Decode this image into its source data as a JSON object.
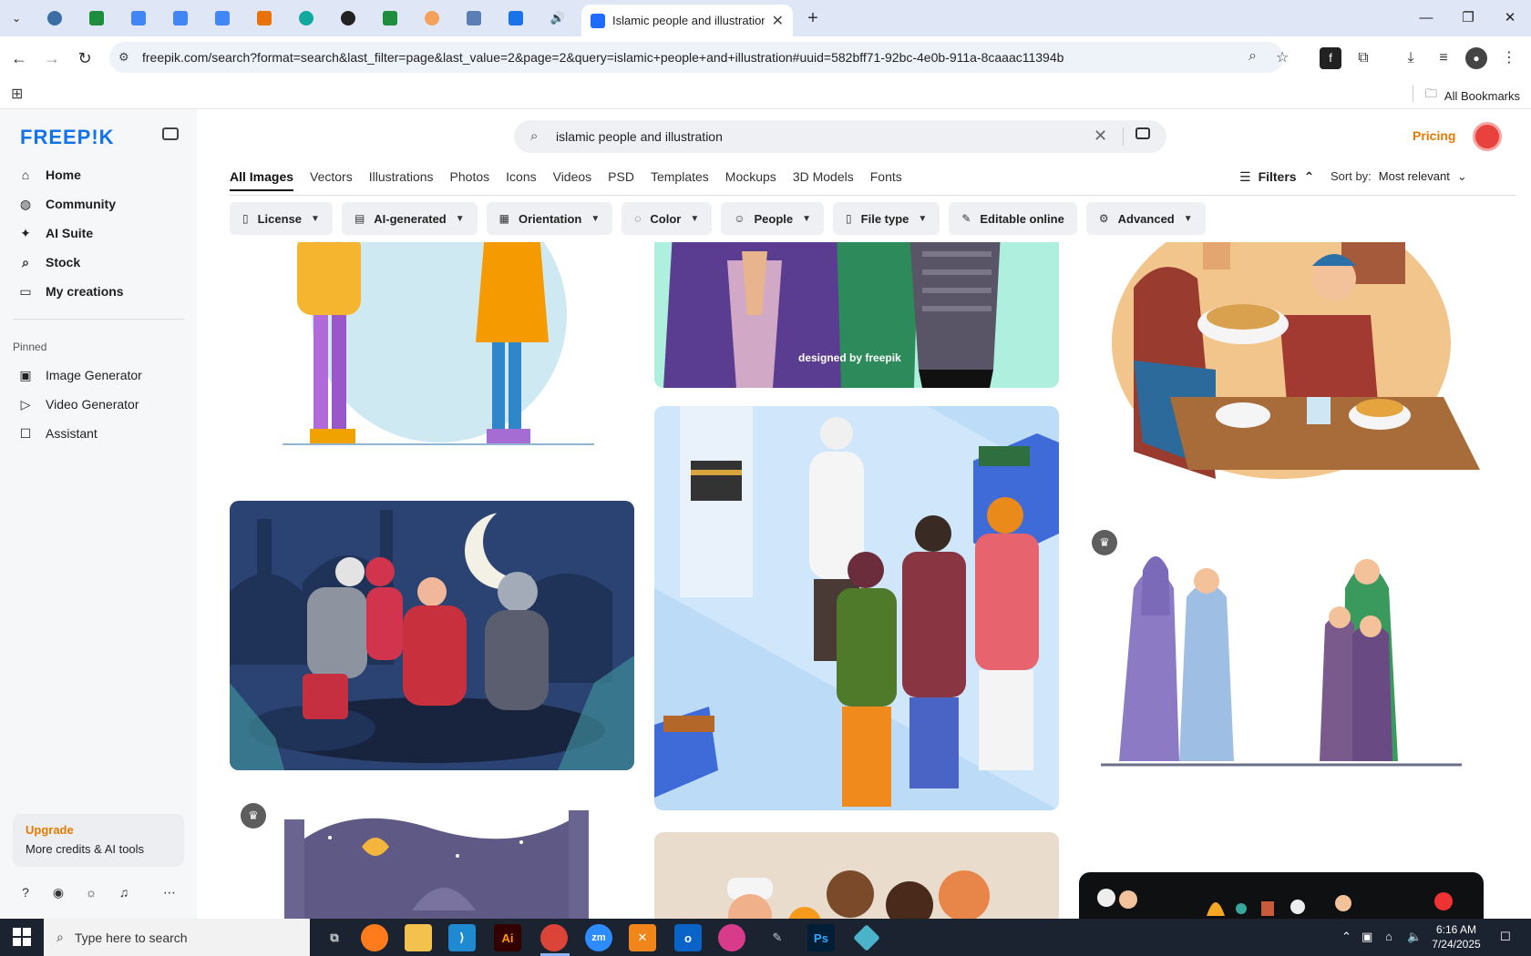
{
  "browser": {
    "active_tab_title": "Islamic people and illustration v",
    "url": "freepik.com/search?format=search&last_filter=page&last_value=2&page=2&query=islamic+people+and+illustration#uuid=582bff71-92bc-4e0b-911a-8caaac11394b",
    "bookmarks_label": "All Bookmarks"
  },
  "sidebar": {
    "logo": "FREEP!K",
    "nav": [
      {
        "label": "Home",
        "icon": "home-icon"
      },
      {
        "label": "Community",
        "icon": "globe-icon"
      },
      {
        "label": "AI Suite",
        "icon": "sparkle-icon"
      },
      {
        "label": "Stock",
        "icon": "search-icon"
      },
      {
        "label": "My creations",
        "icon": "folder-icon"
      }
    ],
    "pinned_label": "Pinned",
    "pinned": [
      {
        "label": "Image Generator",
        "icon": "image-icon"
      },
      {
        "label": "Video Generator",
        "icon": "video-icon"
      },
      {
        "label": "Assistant",
        "icon": "chat-icon"
      }
    ],
    "upgrade": {
      "title": "Upgrade",
      "subtitle": "More credits & AI tools"
    }
  },
  "header": {
    "search_value": "islamic people and illustration",
    "pricing_label": "Pricing"
  },
  "categories": [
    "All Images",
    "Vectors",
    "Illustrations",
    "Photos",
    "Icons",
    "Videos",
    "PSD",
    "Templates",
    "Mockups",
    "3D Models",
    "Fonts"
  ],
  "filters_label": "Filters",
  "sort": {
    "label": "Sort by:",
    "value": "Most relevant"
  },
  "chips": [
    {
      "label": "License",
      "icon": "license-icon"
    },
    {
      "label": "AI-generated",
      "icon": "ai-icon"
    },
    {
      "label": "Orientation",
      "icon": "orientation-icon"
    },
    {
      "label": "Color",
      "icon": "palette-icon"
    },
    {
      "label": "People",
      "icon": "people-icon"
    },
    {
      "label": "File type",
      "icon": "file-icon"
    },
    {
      "label": "Editable online",
      "icon": "pencil-icon"
    },
    {
      "label": "Advanced",
      "icon": "gear-icon"
    }
  ],
  "watermark": "designed by freepik",
  "taskbar": {
    "search_placeholder": "Type here to search",
    "time": "6:16 AM",
    "date": "7/24/2025"
  },
  "colors": {
    "brand": "#1273eb",
    "accent": "#e57a00"
  }
}
